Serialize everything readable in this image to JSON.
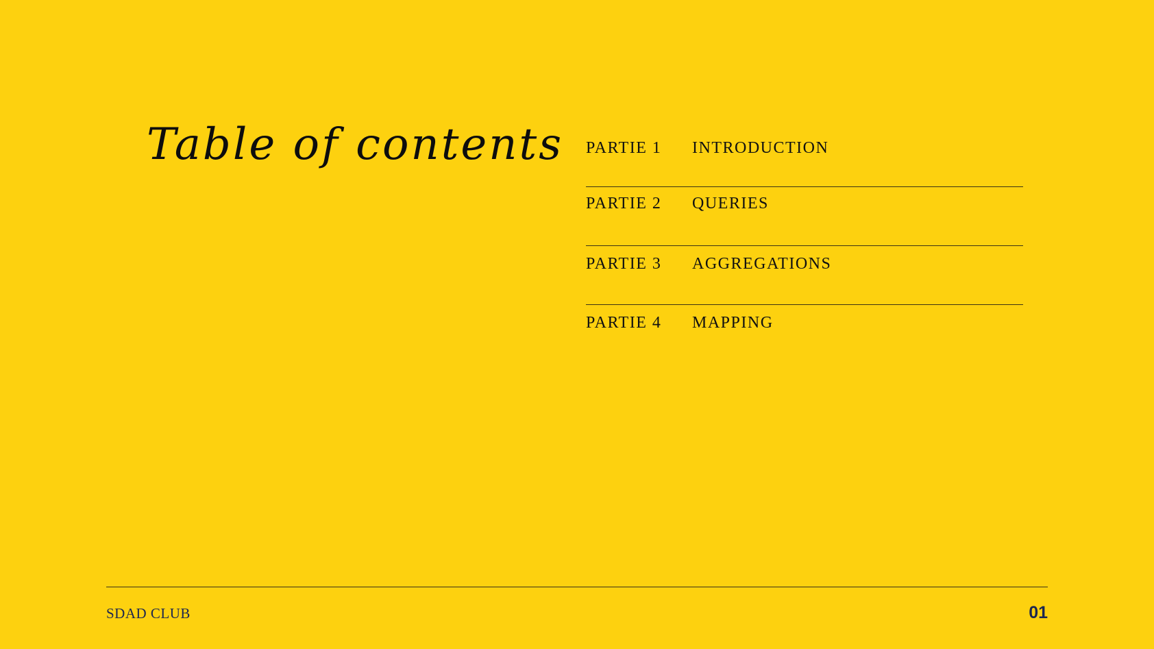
{
  "slide": {
    "title": "Table of contents",
    "background_color": "#FDD10F",
    "items": [
      {
        "part": "PARTIE 1",
        "label": "INTRODUCTION"
      },
      {
        "part": "PARTIE 2",
        "label": "QUERIES"
      },
      {
        "part": "PARTIE 3",
        "label": "AGGREGATIONS"
      },
      {
        "part": "PARTIE 4",
        "label": "MAPPING"
      }
    ]
  },
  "footer": {
    "brand": "SDAD CLUB",
    "page_number": "01"
  }
}
